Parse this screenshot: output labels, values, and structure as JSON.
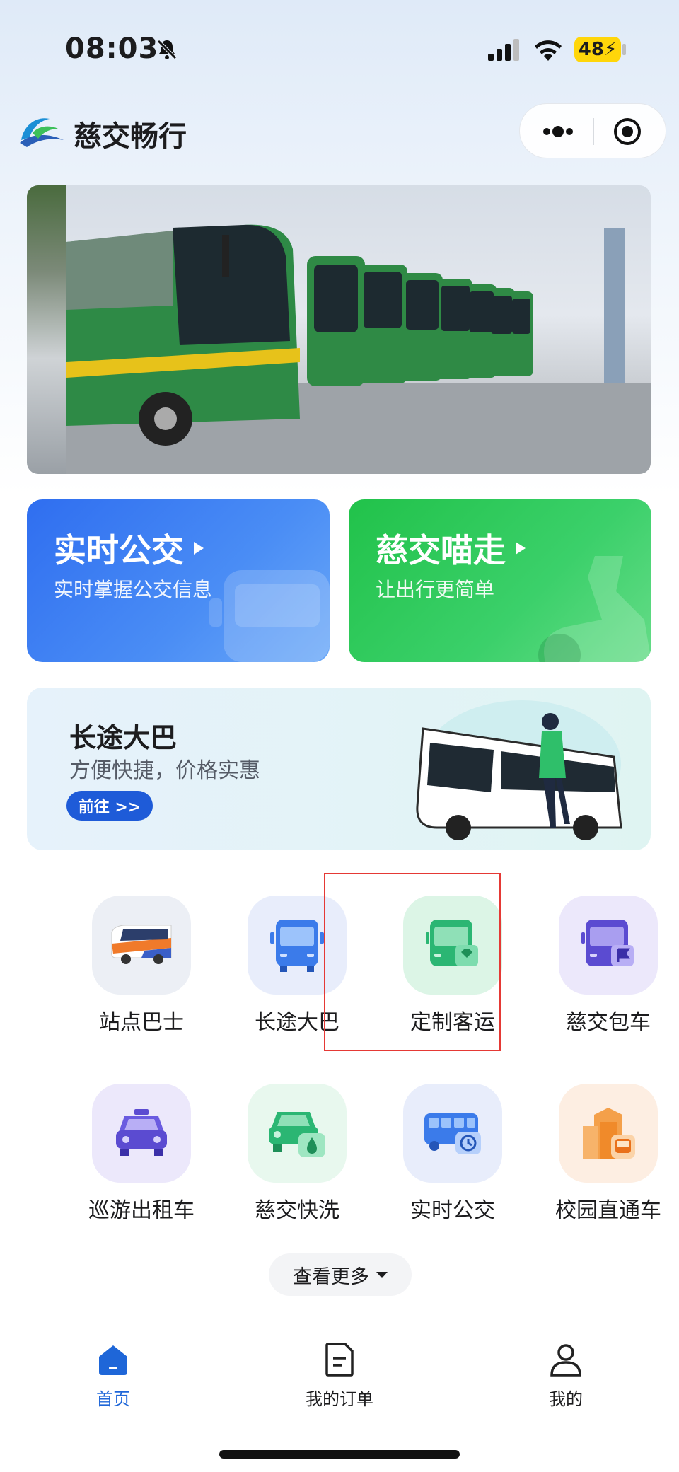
{
  "status_bar": {
    "time": "08:03",
    "battery": "48"
  },
  "header": {
    "app_title": "慈交畅行"
  },
  "banner": {
    "dots": 5,
    "active_dot": 0
  },
  "cards": [
    {
      "title": "实时公交",
      "subtitle": "实时掌握公交信息"
    },
    {
      "title": "慈交喵走",
      "subtitle": "让出行更简单"
    }
  ],
  "long_bus": {
    "title": "长途大巴",
    "subtitle": "方便快捷，价格实惠",
    "button": "前往 >>"
  },
  "services": [
    {
      "label": "站点巴士",
      "icon": "shuttle-bus-icon"
    },
    {
      "label": "长途大巴",
      "icon": "coach-bus-icon"
    },
    {
      "label": "定制客运",
      "icon": "custom-bus-icon"
    },
    {
      "label": "慈交包车",
      "icon": "charter-bus-icon"
    },
    {
      "label": "巡游出租车",
      "icon": "taxi-icon"
    },
    {
      "label": "慈交快洗",
      "icon": "car-wash-icon"
    },
    {
      "label": "实时公交",
      "icon": "realtime-bus-icon"
    },
    {
      "label": "校园直通车",
      "icon": "campus-bus-icon"
    }
  ],
  "more_button": "查看更多",
  "tabbar": [
    {
      "label": "首页",
      "active": true
    },
    {
      "label": "我的订单",
      "active": false
    },
    {
      "label": "我的",
      "active": false
    }
  ],
  "colors": {
    "accent": "#1e66d8",
    "green": "#21c24a",
    "highlight": "#e53935"
  }
}
